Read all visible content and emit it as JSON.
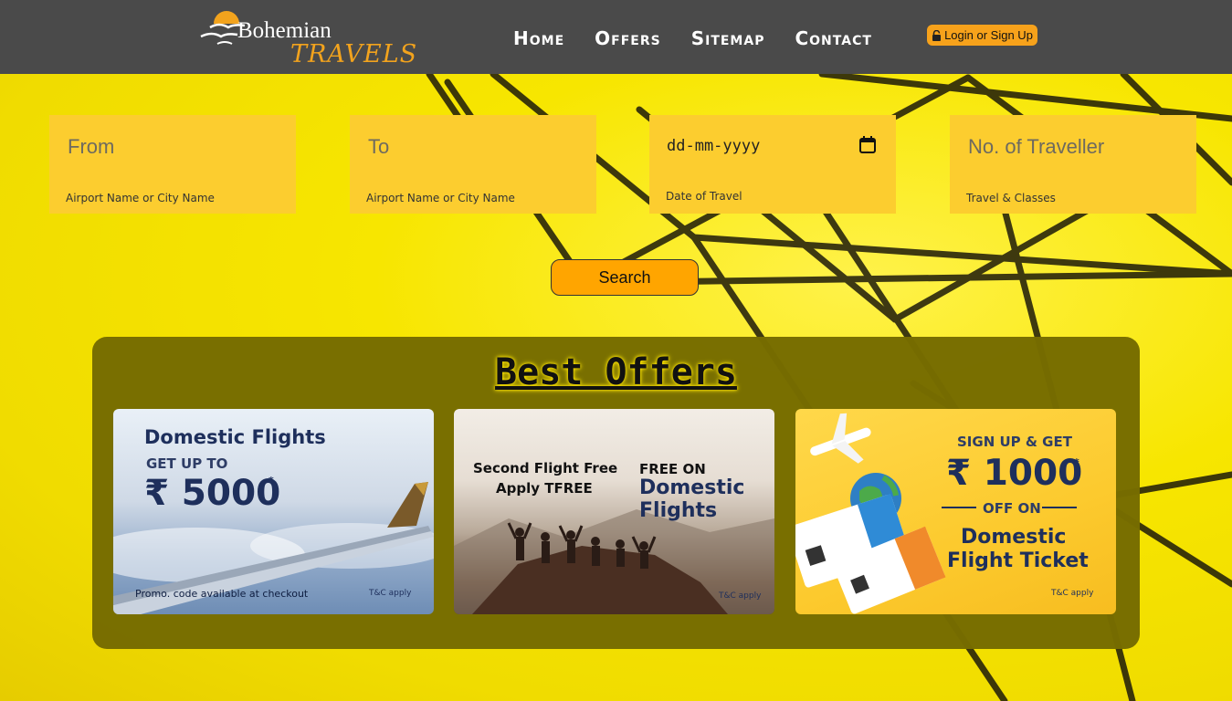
{
  "header": {
    "logo": {
      "word1": "Bohemian",
      "word2": "TRAVELS"
    },
    "nav": [
      "Home",
      "Offers",
      "Sitemap",
      "Contact"
    ],
    "login_label": "Login or Sign Up"
  },
  "search": {
    "from": {
      "placeholder": "From",
      "hint": "Airport Name or City Name"
    },
    "to": {
      "placeholder": "To",
      "hint": "Airport Name or City Name"
    },
    "date": {
      "value": "dd-mm-yyyy",
      "hint": "Date of Travel"
    },
    "travellers": {
      "placeholder": "No. of Traveller",
      "hint": "Travel & Classes"
    },
    "button_label": "Search"
  },
  "offers": {
    "title": "Best Offers",
    "cards": [
      {
        "line1": "Domestic Flights",
        "line2": "GET UP TO",
        "amount": "₹ 5000",
        "star": "*",
        "footer": "Promo. code available at checkout",
        "tc": "T&C apply"
      },
      {
        "left1": "Second Flight Free",
        "left2": "Apply TFREE",
        "right1": "FREE ON",
        "right2": "Domestic",
        "right3": "Flights",
        "tc": "T&C apply"
      },
      {
        "line1": "SIGN UP & GET",
        "amount": "₹ 1000",
        "star": "*",
        "line3": "OFF ON",
        "line4": "Domestic",
        "line5": "Flight Ticket",
        "tc": "T&C apply"
      }
    ]
  },
  "colors": {
    "header_bg": "#4a4a4a",
    "accent_orange": "#ffa500",
    "field_bg": "#fccd2f",
    "offers_bg": "#766c00",
    "page_bg": "#f7e600"
  },
  "icons": [
    "sun-seagull-logo-icon",
    "lock-icon",
    "calendar-icon"
  ]
}
